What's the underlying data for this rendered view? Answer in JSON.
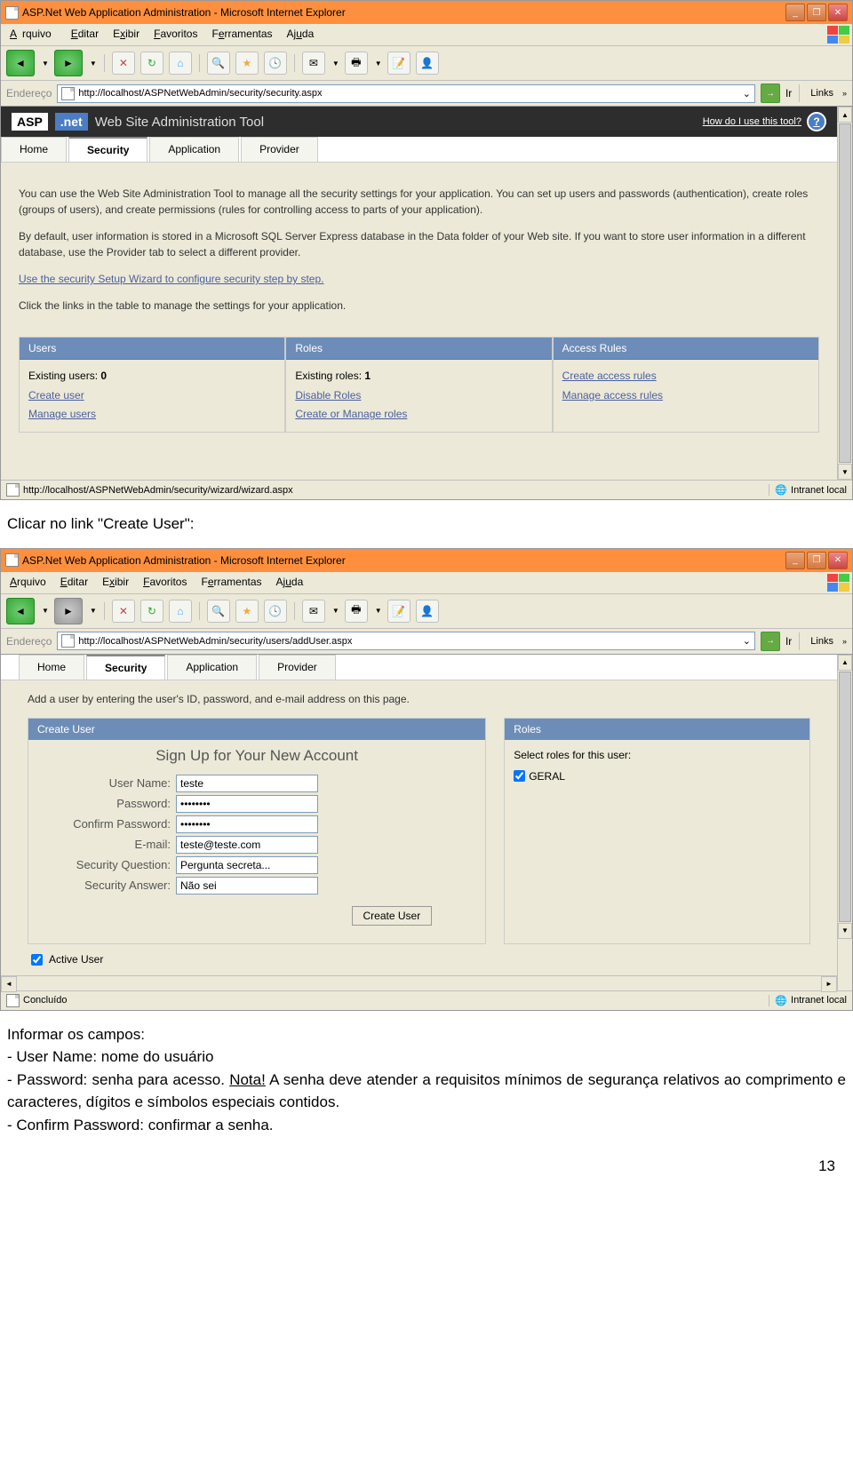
{
  "doc": {
    "click_create": "Clicar no link \"Create User\":",
    "informar": "Informar os campos:",
    "username_line": "- User Name: nome do usuário",
    "password_line": "- Password: senha para acesso. ",
    "nota": "Nota!",
    "nota_text": " A senha deve atender a requisitos mínimos de segurança relativos ao comprimento e caracteres, dígitos e símbolos especiais contidos.",
    "confirm_line": "- Confirm Password: confirmar a senha.",
    "page_num": "13"
  },
  "browser1": {
    "title": "ASP.Net Web Application Administration - Microsoft Internet Explorer",
    "menu": {
      "arquivo": "Arquivo",
      "editar": "Editar",
      "exibir": "Exibir",
      "favoritos": "Favoritos",
      "ferramentas": "Ferramentas",
      "ajuda": "Ajuda"
    },
    "addr_label": "Endereço",
    "addr": "http://localhost/ASPNetWebAdmin/security/security.aspx",
    "go": "Ir",
    "links": "Links",
    "asp": {
      "logo": "ASP",
      "net": ".net",
      "title": "Web Site Administration Tool",
      "help": "How do I use this tool?"
    },
    "tabs": {
      "home": "Home",
      "security": "Security",
      "application": "Application",
      "provider": "Provider"
    },
    "para1": "You can use the Web Site Administration Tool to manage all the security settings for your application. You can set up users and passwords (authentication), create roles (groups of users), and create permissions (rules for controlling access to parts of your application).",
    "para2": "By default, user information is stored in a Microsoft SQL Server Express database in the Data folder of your Web site. If you want to store user information in a different database, use the Provider tab to select a different provider.",
    "wizard_link": "Use the security Setup Wizard to configure security step by step.",
    "para3": "Click the links in the table to manage the settings for your application.",
    "cols": {
      "users": {
        "hdr": "Users",
        "existing": "Existing users: 0",
        "create": "Create user",
        "manage": "Manage users"
      },
      "roles": {
        "hdr": "Roles",
        "existing": "Existing roles: 1",
        "disable": "Disable Roles",
        "manage": "Create or Manage roles"
      },
      "access": {
        "hdr": "Access Rules",
        "create": "Create access rules",
        "manage": "Manage access rules"
      }
    },
    "status_url": "http://localhost/ASPNetWebAdmin/security/wizard/wizard.aspx",
    "status_zone": "Intranet local"
  },
  "browser2": {
    "title": "ASP.Net Web Application Administration - Microsoft Internet Explorer",
    "addr": "http://localhost/ASPNetWebAdmin/security/users/addUser.aspx",
    "intro": "Add a user by entering the user's ID, password, and e-mail address on this page.",
    "create_hdr": "Create User",
    "roles_hdr": "Roles",
    "signup": "Sign Up for Your New Account",
    "labels": {
      "user": "User Name:",
      "pass": "Password:",
      "conf": "Confirm Password:",
      "email": "E-mail:",
      "secq": "Security Question:",
      "seca": "Security Answer:"
    },
    "values": {
      "user": "teste",
      "pass": "••••••••",
      "conf": "••••••••",
      "email": "teste@teste.com",
      "secq": "Pergunta secreta...",
      "seca": "Não sei"
    },
    "create_btn": "Create User",
    "roles_text": "Select roles for this user:",
    "role_item": "GERAL",
    "active": "Active User",
    "status": "Concluído",
    "status_zone": "Intranet local"
  }
}
